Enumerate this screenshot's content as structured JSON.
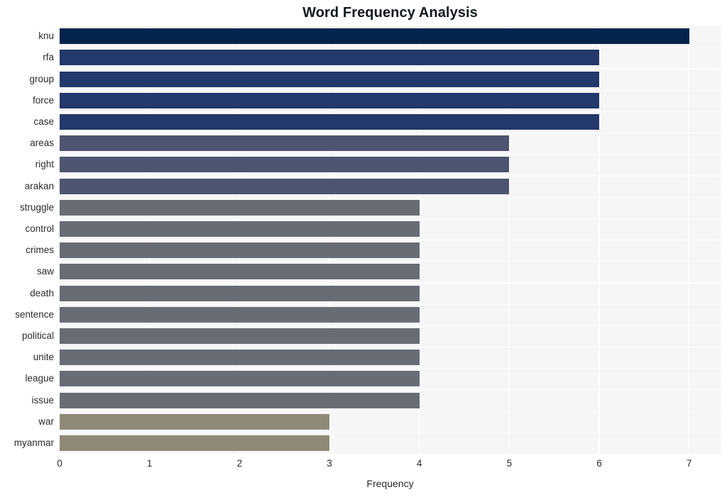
{
  "chart_data": {
    "type": "bar",
    "orientation": "horizontal",
    "title": "Word Frequency Analysis",
    "xlabel": "Frequency",
    "ylabel": "",
    "xlim": [
      0,
      7.35
    ],
    "ylim": [
      0,
      20
    ],
    "grid": true,
    "legend": null,
    "xticks": [
      "0",
      "1",
      "2",
      "3",
      "4",
      "5",
      "6",
      "7"
    ],
    "xtick_values": [
      0,
      1,
      2,
      3,
      4,
      5,
      6,
      7
    ],
    "categories": [
      "knu",
      "rfa",
      "group",
      "force",
      "case",
      "areas",
      "right",
      "arakan",
      "struggle",
      "control",
      "crimes",
      "saw",
      "death",
      "sentence",
      "political",
      "unite",
      "league",
      "issue",
      "war",
      "myanmar"
    ],
    "values": [
      7,
      6,
      6,
      6,
      6,
      5,
      5,
      5,
      4,
      4,
      4,
      4,
      4,
      4,
      4,
      4,
      4,
      4,
      3,
      3
    ],
    "bar_colors": [
      "#04234d",
      "#23386b",
      "#23386b",
      "#23386b",
      "#23386b",
      "#4c5470",
      "#4c5470",
      "#4c5470",
      "#6a6c73",
      "#6a6c73",
      "#6a6c73",
      "#6a6c73",
      "#6a6c73",
      "#6a6c73",
      "#6a6c73",
      "#6a6c73",
      "#6a6c73",
      "#6a6c73",
      "#8e8a78",
      "#8e8a78"
    ],
    "plot_background": "#f6f6f7",
    "figure_background": "#ffffff",
    "gridline_color": "#ffffff",
    "title_color": "#12181f",
    "tick_label_color": "#2b2b2b"
  }
}
